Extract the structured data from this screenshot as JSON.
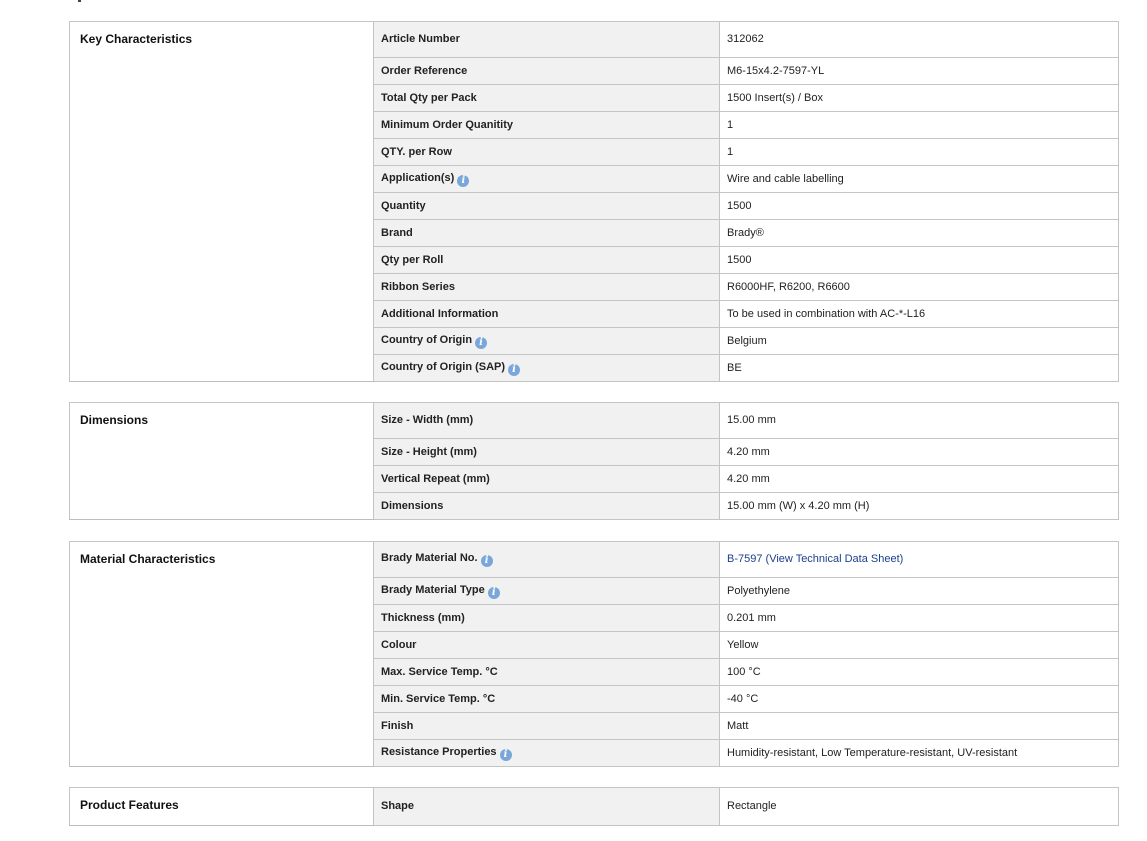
{
  "sections": [
    {
      "title": "Key Characteristics",
      "rows": [
        {
          "label": "Article Number",
          "value": "312062"
        },
        {
          "label": "Order Reference",
          "value": "M6-15x4.2-7597-YL"
        },
        {
          "label": "Total Qty per Pack",
          "value": "1500 Insert(s) / Box"
        },
        {
          "label": "Minimum Order Quanitity",
          "value": "1"
        },
        {
          "label": "QTY. per Row",
          "value": "1"
        },
        {
          "label": "Application(s)",
          "value": "Wire and cable labelling",
          "info": true
        },
        {
          "label": "Quantity",
          "value": "1500"
        },
        {
          "label": "Brand",
          "value": "Brady®"
        },
        {
          "label": "Qty per Roll",
          "value": "1500"
        },
        {
          "label": "Ribbon Series",
          "value": "R6000HF, R6200, R6600"
        },
        {
          "label": "Additional Information",
          "value": "To be used in combination with AC-*-L16"
        },
        {
          "label": "Country of Origin",
          "value": "Belgium",
          "info": true
        },
        {
          "label": "Country of Origin (SAP)",
          "value": "BE",
          "info": true
        }
      ]
    },
    {
      "title": "Dimensions",
      "rows": [
        {
          "label": "Size - Width (mm)",
          "value": "15.00 mm"
        },
        {
          "label": "Size - Height (mm)",
          "value": "4.20 mm"
        },
        {
          "label": "Vertical Repeat (mm)",
          "value": "4.20 mm"
        },
        {
          "label": "Dimensions",
          "value": "15.00 mm (W) x 4.20 mm (H)"
        }
      ]
    },
    {
      "title": "Material Characteristics",
      "rows": [
        {
          "label": "Brady Material No.",
          "value": "B-7597 (View Technical Data Sheet)",
          "info": true,
          "link": true
        },
        {
          "label": "Brady Material Type",
          "value": "Polyethylene",
          "info": true
        },
        {
          "label": "Thickness (mm)",
          "value": "0.201 mm"
        },
        {
          "label": "Colour",
          "value": "Yellow"
        },
        {
          "label": "Max. Service Temp. °C",
          "value": "100 °C"
        },
        {
          "label": "Min. Service Temp. °C",
          "value": "-40 °C"
        },
        {
          "label": "Finish",
          "value": "Matt"
        },
        {
          "label": "Resistance Properties",
          "value": "Humidity-resistant, Low Temperature-resistant, UV-resistant",
          "info": true
        }
      ]
    },
    {
      "title": "Product Features",
      "rows": [
        {
          "label": "Shape",
          "value": "Rectangle"
        }
      ]
    }
  ],
  "info_icon_glyph": "i",
  "colors": {
    "label_bg": "#f1f1f1",
    "border": "#c4c4c4",
    "link": "#1c3f8f",
    "info_icon": "#7aa7d9"
  }
}
